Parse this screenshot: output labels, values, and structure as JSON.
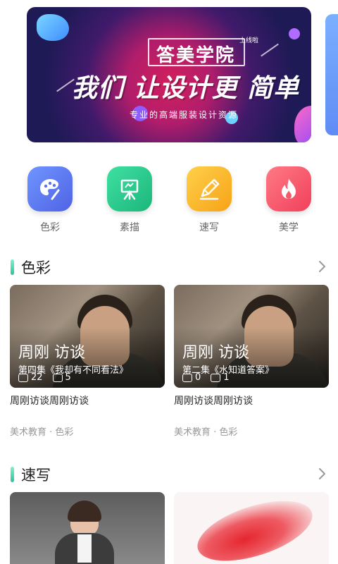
{
  "banner": {
    "brand": "答美学院",
    "tag": "上线啦",
    "headline": "我们 让设计更 简单",
    "subline": "专业的高端服装设计资源"
  },
  "categories": [
    {
      "label": "色彩",
      "icon": "palette-icon",
      "color": "#5b7ff0"
    },
    {
      "label": "素描",
      "icon": "easel-icon",
      "color": "#28c88e"
    },
    {
      "label": "速写",
      "icon": "pencil-icon",
      "color": "#f5b324"
    },
    {
      "label": "美学",
      "icon": "flame-icon",
      "color": "#f4506a"
    }
  ],
  "sections": [
    {
      "title": "色彩",
      "cards": [
        {
          "thumb_title": "周刚 访谈",
          "thumb_subtitle": "第四集《我却有不同看法》",
          "plays": "22",
          "comments": "5",
          "name": "周刚访谈周刚访谈",
          "meta": "美术教育 · 色彩"
        },
        {
          "thumb_title": "周刚 访谈",
          "thumb_subtitle": "第二集《水知道答案》",
          "plays": "0",
          "comments": "1",
          "name": "周刚访谈周刚访谈",
          "meta": "美术教育 · 色彩"
        }
      ]
    },
    {
      "title": "速写"
    }
  ]
}
